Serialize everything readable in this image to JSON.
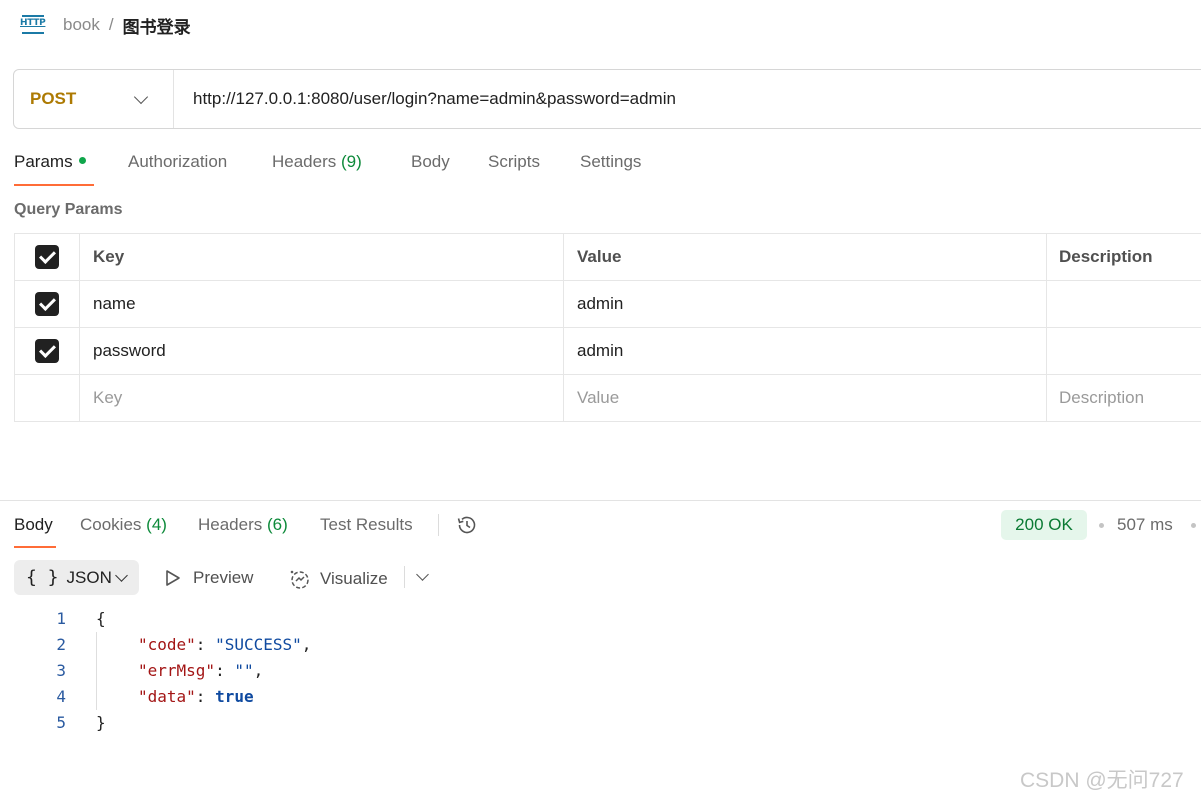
{
  "breadcrumb": {
    "icon": "http-icon",
    "icon_text": "HTTP",
    "parent": "book",
    "separator": "/",
    "current": "图书登录"
  },
  "request": {
    "method": "POST",
    "url": "http://127.0.0.1:8080/user/login?name=admin&password=admin"
  },
  "request_tabs": [
    {
      "label": "Params",
      "active": true,
      "has_dot": true
    },
    {
      "label": "Authorization"
    },
    {
      "label": "Headers",
      "count": "(9)"
    },
    {
      "label": "Body"
    },
    {
      "label": "Scripts"
    },
    {
      "label": "Settings"
    }
  ],
  "query_params": {
    "title": "Query Params",
    "headers": {
      "key": "Key",
      "value": "Value",
      "description": "Description"
    },
    "rows": [
      {
        "checked": true,
        "key": "name",
        "value": "admin",
        "description": ""
      },
      {
        "checked": true,
        "key": "password",
        "value": "admin",
        "description": ""
      }
    ],
    "empty_row": {
      "key": "Key",
      "value": "Value",
      "description": "Description"
    }
  },
  "response_tabs": [
    {
      "label": "Body",
      "active": true
    },
    {
      "label": "Cookies",
      "count": "(4)"
    },
    {
      "label": "Headers",
      "count": "(6)"
    },
    {
      "label": "Test Results"
    }
  ],
  "response_meta": {
    "status": "200 OK",
    "time": "507 ms"
  },
  "response_toolbar": {
    "format": "JSON",
    "format_icon": "{ }",
    "preview": "Preview",
    "visualize": "Visualize"
  },
  "response_body": {
    "line_numbers": [
      "1",
      "2",
      "3",
      "4",
      "5"
    ],
    "open_brace": "{",
    "close_brace": "}",
    "fields": [
      {
        "key": "\"code\"",
        "value": "\"SUCCESS\"",
        "trail": ","
      },
      {
        "key": "\"errMsg\"",
        "value": "\"\"",
        "trail": ","
      },
      {
        "key": "\"data\"",
        "value": "true",
        "trail": ""
      }
    ]
  },
  "watermark": "CSDN @无问727",
  "colors": {
    "method": "#ad7a03",
    "accent": "#ff6c37",
    "status_bg": "#e5f6eb",
    "status_text": "#0a7a33",
    "count_green": "#0d8a3a",
    "json_key": "#a31515",
    "json_value": "#0f4aa0"
  }
}
